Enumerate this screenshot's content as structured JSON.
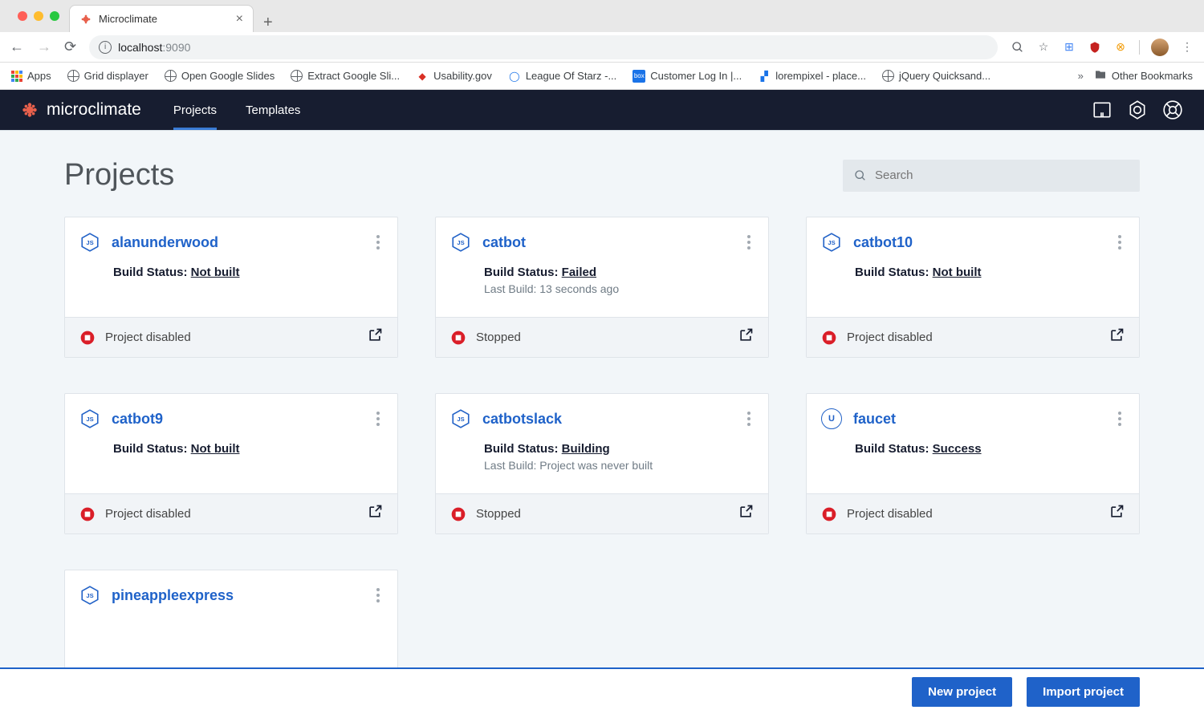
{
  "browser": {
    "tab_title": "Microclimate",
    "url_host": "localhost",
    "url_port": ":9090",
    "bookmarks": [
      {
        "label": "Apps"
      },
      {
        "label": "Grid displayer"
      },
      {
        "label": "Open Google Slides"
      },
      {
        "label": "Extract Google Sli..."
      },
      {
        "label": "Usability.gov"
      },
      {
        "label": "League Of Starz -..."
      },
      {
        "label": "Customer Log In |..."
      },
      {
        "label": "lorempixel - place..."
      },
      {
        "label": "jQuery Quicksand..."
      }
    ],
    "other_bookmarks": "Other Bookmarks"
  },
  "header": {
    "brand": "microclimate",
    "nav": {
      "projects": "Projects",
      "templates": "Templates"
    }
  },
  "page": {
    "title": "Projects",
    "search_placeholder": "Search"
  },
  "labels": {
    "build_status_prefix": "Build Status: ",
    "last_build_prefix": "Last Build: "
  },
  "projects": [
    {
      "name": "alanunderwood",
      "icon": "JS",
      "build_status": "Not built",
      "last_build": "",
      "run_status": "Project disabled"
    },
    {
      "name": "catbot",
      "icon": "JS",
      "build_status": "Failed",
      "last_build": "13 seconds ago",
      "run_status": "Stopped"
    },
    {
      "name": "catbot10",
      "icon": "JS",
      "build_status": "Not built",
      "last_build": "",
      "run_status": "Project disabled"
    },
    {
      "name": "catbot9",
      "icon": "JS",
      "build_status": "Not built",
      "last_build": "",
      "run_status": "Project disabled"
    },
    {
      "name": "catbotslack",
      "icon": "JS",
      "build_status": "Building",
      "last_build": "Project was never built",
      "run_status": "Stopped"
    },
    {
      "name": "faucet",
      "icon": "U",
      "build_status": "Success",
      "last_build": "",
      "run_status": "Project disabled"
    },
    {
      "name": "pineappleexpress",
      "icon": "JS",
      "build_status": "",
      "last_build": "",
      "run_status": ""
    }
  ],
  "buttons": {
    "new_project": "New project",
    "import_project": "Import project"
  }
}
